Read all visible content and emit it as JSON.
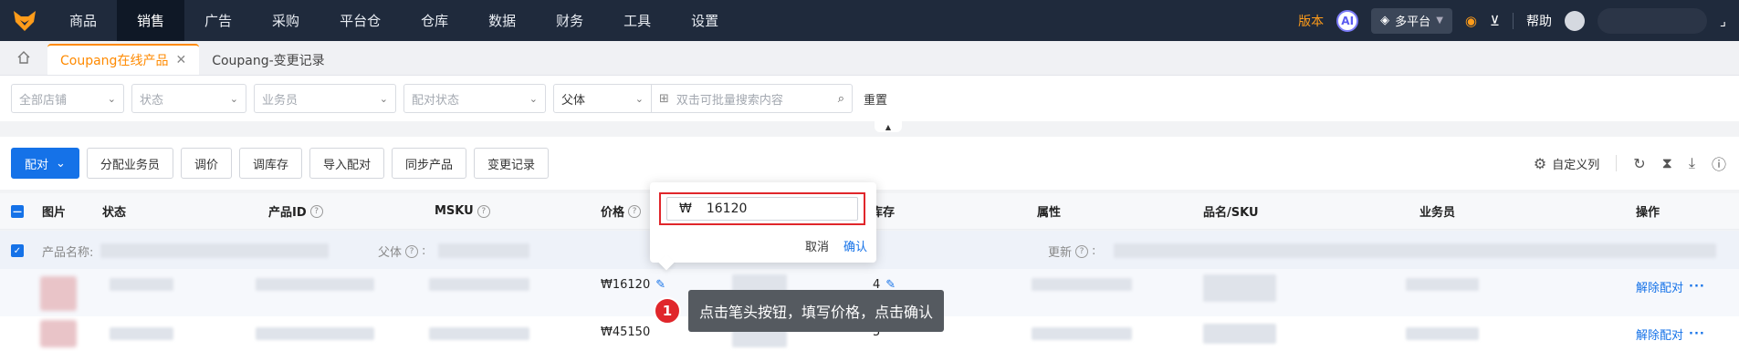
{
  "nav": {
    "items": [
      "商品",
      "销售",
      "广告",
      "采购",
      "平台仓",
      "仓库",
      "数据",
      "财务",
      "工具",
      "设置"
    ],
    "active_index": 1,
    "version_label": "版本",
    "ai_label": "AI",
    "platform_label": "多平台",
    "help_label": "帮助"
  },
  "tabs": {
    "items": [
      {
        "label": "Coupang在线产品",
        "active": true
      },
      {
        "label": "Coupang-变更记录",
        "active": false
      }
    ]
  },
  "filters": {
    "store": "全部店铺",
    "status": "状态",
    "salesperson": "业务员",
    "match_status": "配对状态",
    "level": "父体",
    "search_placeholder": "双击可批量搜索内容",
    "reset": "重置"
  },
  "toolbar": {
    "match": "配对",
    "assign": "分配业务员",
    "adjust_price": "调价",
    "adjust_stock": "调库存",
    "import_match": "导入配对",
    "sync": "同步产品",
    "change_log": "变更记录",
    "custom_columns": "自定义列"
  },
  "table": {
    "headers": [
      "图片",
      "状态",
      "产品ID",
      "MSKU",
      "价格",
      "库存",
      "属性",
      "品名/SKU",
      "业务员",
      "操作"
    ],
    "group_row": {
      "product_name_label": "产品名称:",
      "parent_label": "父体",
      "updated_label": "更新"
    },
    "rows": [
      {
        "price": "₩16120",
        "stock": "4",
        "action": "解除配对",
        "more": "···"
      },
      {
        "price": "₩45150",
        "stock": "5",
        "action": "解除配对",
        "more": "···"
      }
    ]
  },
  "popover": {
    "currency": "₩",
    "value": "16120",
    "cancel": "取消",
    "confirm": "确认"
  },
  "tooltip": {
    "step": "1",
    "text": "点击笔头按钮，填写价格，点击确认"
  },
  "colors": {
    "nav_bg": "#1f2a3c",
    "accent": "#ff8a00",
    "primary": "#1572e8",
    "highlight": "#e0262b"
  }
}
